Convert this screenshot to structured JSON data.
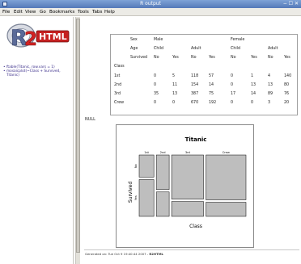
{
  "window": {
    "title": "R output",
    "controls": "− ☐ ✕"
  },
  "menubar": [
    "File",
    "Edit",
    "View",
    "Go",
    "Bookmarks",
    "Tools",
    "Tabs",
    "Help"
  ],
  "sidebar": {
    "logo_text": "2",
    "logo_text_right": "HTML",
    "items": [
      "ftable(Titanic, row.vars = 1)",
      "mosaicplot(~Class + Survived, Titanic)"
    ]
  },
  "table": {
    "header_rows": [
      [
        "",
        "Sex",
        "Male",
        "",
        "",
        "",
        "Female",
        "",
        "",
        ""
      ],
      [
        "",
        "Age",
        "Child",
        "",
        "Adult",
        "",
        "Child",
        "",
        "Adult",
        ""
      ],
      [
        "",
        "Survived",
        "No",
        "Yes",
        "No",
        "Yes",
        "No",
        "Yes",
        "No",
        "Yes"
      ]
    ],
    "row_var": "Class",
    "rows": [
      {
        "label": "1st",
        "values": [
          "0",
          "5",
          "118",
          "57",
          "0",
          "1",
          "4",
          "140"
        ]
      },
      {
        "label": "2nd",
        "values": [
          "0",
          "11",
          "154",
          "14",
          "0",
          "13",
          "13",
          "80"
        ]
      },
      {
        "label": "3rd",
        "values": [
          "35",
          "13",
          "387",
          "75",
          "17",
          "14",
          "89",
          "76"
        ]
      },
      {
        "label": "Crew",
        "values": [
          "0",
          "0",
          "670",
          "192",
          "0",
          "0",
          "3",
          "20"
        ]
      }
    ]
  },
  "null_output": "NULL",
  "chart_data": {
    "type": "mosaic",
    "title": "Titanic",
    "xlabel": "Class",
    "ylabel": "Survived",
    "categories": [
      "1st",
      "2nd",
      "3rd",
      "Crew"
    ],
    "y_categories": [
      "No",
      "Yes"
    ],
    "counts": {
      "1st": {
        "No": 122,
        "Yes": 203
      },
      "2nd": {
        "No": 167,
        "Yes": 118
      },
      "3rd": {
        "No": 528,
        "Yes": 178
      },
      "Crew": {
        "No": 673,
        "Yes": 212
      }
    },
    "fill_color": "#bebebe",
    "stroke_color": "#000000"
  },
  "footer": {
    "prefix": "Generated on: Tue Oct 9 19:40:44 2007 - ",
    "suffix": "R2HTML"
  }
}
